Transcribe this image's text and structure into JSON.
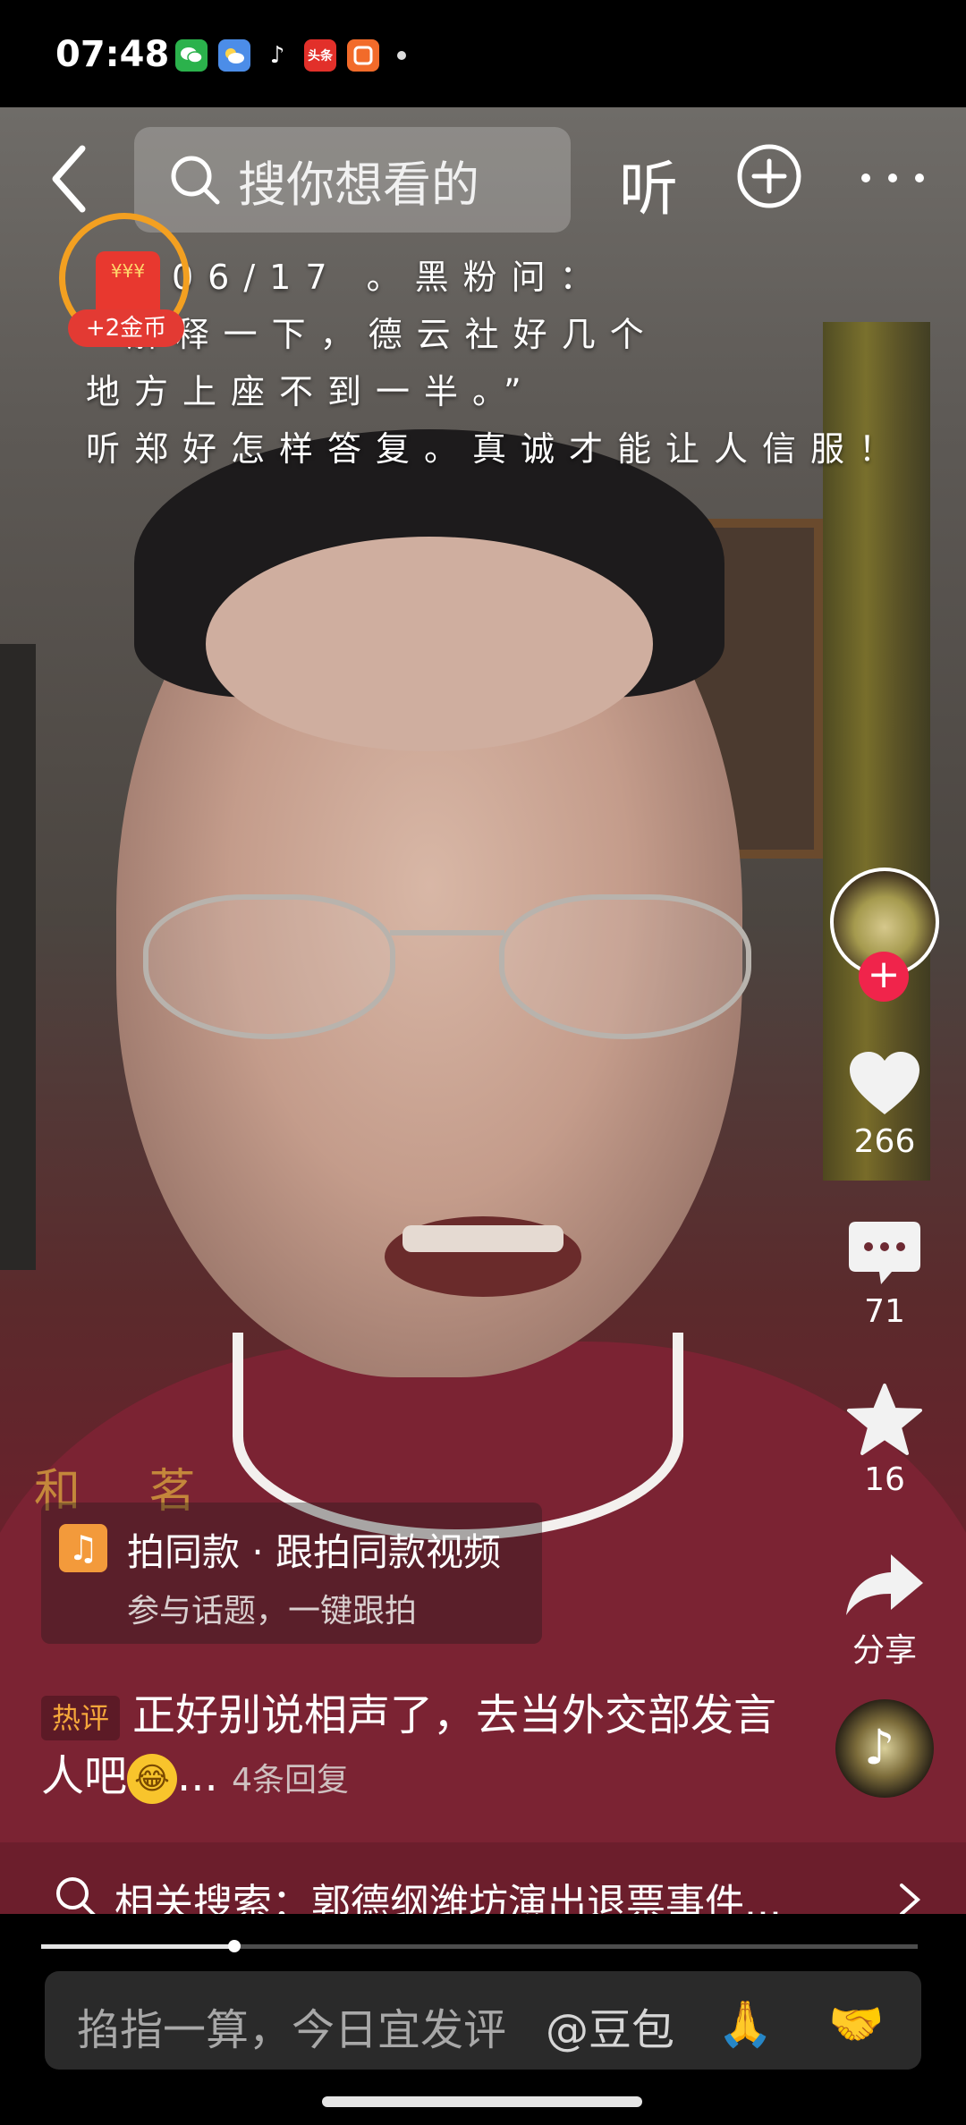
{
  "status_bar": {
    "time": "07:48",
    "app_icons": [
      {
        "name": "wechat-icon",
        "color": "#2bb24c",
        "label": ""
      },
      {
        "name": "weather-icon",
        "color": "#4c8de8",
        "label": ""
      },
      {
        "name": "douyin-icon",
        "color": "#000000",
        "label": "♪"
      },
      {
        "name": "toutiao-icon",
        "color": "#e2302a",
        "label": "头条"
      },
      {
        "name": "douyin-lite-icon",
        "color": "#f26b2a",
        "label": ""
      }
    ]
  },
  "top_bar": {
    "search_placeholder": "搜你想看的",
    "listen_label": "听"
  },
  "caption": {
    "lines": [
      "06/17 。黑粉问：",
      "“解释一下，德云社好几个",
      "地方上座不到一半。”",
      "听郑好怎样答复。真诚才能让人信服！"
    ]
  },
  "coin_reward": {
    "packet_text": "¥¥¥",
    "badge": "+2金币"
  },
  "shirt_text": "和 茗",
  "right_rail": {
    "like_count": "266",
    "comment_count": "71",
    "favorite_count": "16",
    "share_label": "分享"
  },
  "template_chip": {
    "title": "拍同款 · 跟拍同款视频",
    "subtitle": "参与话题，一键跟拍"
  },
  "hot_comment": {
    "tag": "热评",
    "text": "正好别说相声了，去当外交部发言人吧",
    "ellipsis": "...",
    "replies": "4条回复"
  },
  "related_search": {
    "text": "相关搜索：郭德纲潍坊演出退票事件..."
  },
  "progress": {
    "fraction": 0.22
  },
  "comment_bar": {
    "placeholder": "掐指一算，今日宜发评",
    "mention": "@豆包",
    "emoji_1": "🙏",
    "emoji_2": "🤝"
  },
  "colors": {
    "accent_red": "#f0244b",
    "coin_orange": "#f3a021",
    "hot_tag": "#f4a63b"
  }
}
